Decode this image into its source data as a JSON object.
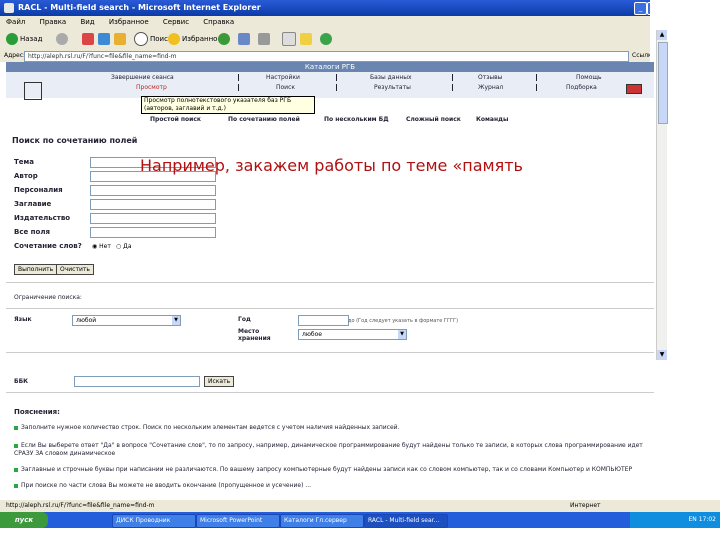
{
  "window": {
    "title": "RACL - Multi-field search - Microsoft Internet Explorer"
  },
  "menu": [
    "Файл",
    "Правка",
    "Вид",
    "Избранное",
    "Сервис",
    "Справка"
  ],
  "toolbar": {
    "back": "Назад",
    "search": "Поиск",
    "favorites": "Избранное"
  },
  "address": {
    "label": "Адрес:",
    "value": "http://aleph.rsl.ru/F/?func=file&file_name=find-m",
    "go": "Ссылки"
  },
  "site": {
    "banner": "Каталоги РГБ",
    "nav_top": [
      "Завершение сеанса",
      "Настройки",
      "Базы данных",
      "Отзывы",
      "Помощь"
    ],
    "nav_bottom": [
      "Просмотр",
      "Поиск",
      "Результаты",
      "Журнал",
      "Подборка"
    ],
    "tooltip": "Просмотр полнотекстового указателя баз РГБ (авторов, заглавий и т.д.)",
    "search_tabs": [
      "Простой поиск",
      "По сочетанию полей",
      "По нескольким БД",
      "Сложный поиск",
      "Команды"
    ]
  },
  "form": {
    "heading": "Поиск по сочетанию полей",
    "fields": [
      "Тема",
      "Автор",
      "Персоналия",
      "Заглавие",
      "Издательство",
      "Все поля"
    ],
    "coupled_label": "Сочетание слов?",
    "yes": "Нет",
    "no": "Да",
    "submit": "Выполнить",
    "clear": "Очистить",
    "limits_label": "Ограничение поиска:",
    "lang_label": "Язык",
    "lang_value": "любой",
    "year_label": "Год",
    "year_hint": "до   (Год следует указать в формате ГГГГ)",
    "place_label": "Место хранения",
    "place_value": "любое",
    "bbk_label": "ББК",
    "bbk_button": "Искать"
  },
  "overlay": {
    "text": "Например, закажем работы по теме «память"
  },
  "notes": {
    "heading": "Пояснения:",
    "items": [
      "Заполните нужное количество строк. Поиск по нескольким элементам ведется с учетом наличия найденных записей.",
      "Если Вы выберете ответ \"Да\" в вопросе \"Сочетание слов\", то по запросу, например, динамическое программирование будут найдены только те записи, в которых слова программирование идет СРАЗУ ЗА словом динамическое",
      "Заглавные и строчные буквы при написании не различаются. По вашему запросу компьютерные будут найдены записи как со словом компьютер, так и со словами Компьютер и КОМПЬЮТЕР",
      "При поиске по части слова Вы можете не вводить окончание (пропущенное и усечение) ..."
    ]
  },
  "status": {
    "left": "http://aleph.rsl.ru/F/?func=file&file_name=find-m",
    "right": "Интернет"
  },
  "taskbar": {
    "start": "пуск",
    "tasks": [
      "ДИСК Проводник",
      "Microsoft PowerPoint",
      "Каталоги Гл.сервер",
      "RACL - Multi-field sear..."
    ],
    "tray": "EN  17:02"
  }
}
